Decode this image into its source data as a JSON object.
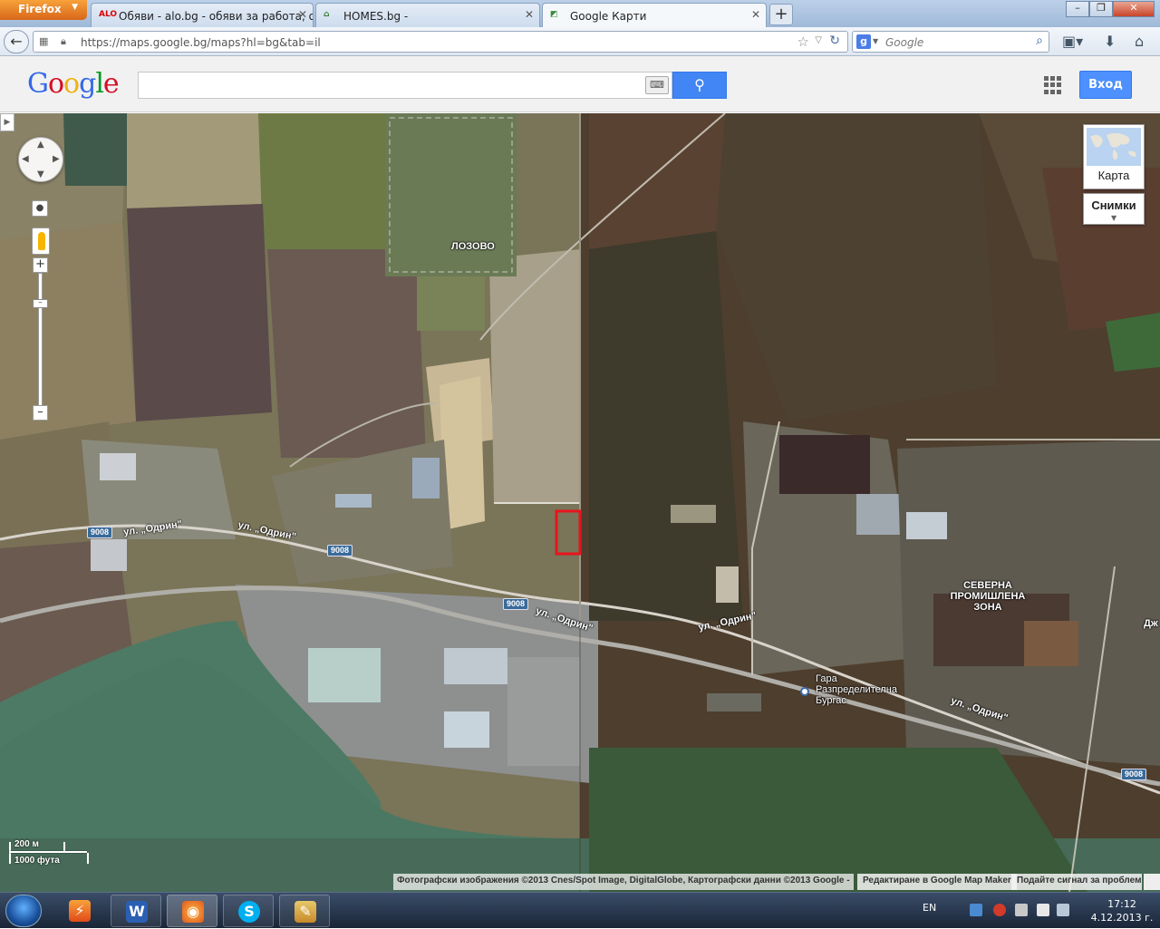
{
  "browser": {
    "menu_button": "Firefox",
    "tabs": [
      {
        "label": "Обяви - alo.bg - обяви за работа, об...",
        "icon": "alo-icon"
      },
      {
        "label": "HOMES.bg -",
        "icon": "homes-icon"
      },
      {
        "label": "Google Карти",
        "icon": "google-maps-icon"
      }
    ],
    "url": "https://maps.google.bg/maps?hl=bg&tab=il",
    "search_placeholder": "Google"
  },
  "header": {
    "logo": [
      "G",
      "o",
      "o",
      "g",
      "l",
      "e"
    ],
    "search_value": "",
    "signin_label": "Вход"
  },
  "map": {
    "labels": {
      "village": "ЛОЗОВО",
      "street_west_1": "ул. „Одрин\"",
      "street_west_2": "ул. „Одрин\"",
      "street_mid": "ул. „Одрин\"",
      "street_east_1": "ул. „Одрин\"",
      "street_east_2": "ул. „Одрин\"",
      "zone": "СЕВЕРНА ПРОМИШЛЕНА ЗОНА",
      "station": "Гара Разпределителна Бургас",
      "edge": "Дж"
    },
    "road_shields": [
      "9008",
      "9008",
      "9008",
      "9008"
    ],
    "map_type_map": "Карта",
    "map_type_satellite": "Снимки",
    "scale_metric": "200 м",
    "scale_imperial": "1000 фута",
    "attribution": "Фотографски изображения ©2013 Cnes/Spot Image, DigitalGlobe, Картографски данни ©2013 Google -",
    "map_maker_link": "Редактиране в Google Map Maker",
    "report_link": "Подайте сигнал за проблем",
    "marker_color": "#e8141c"
  },
  "taskbar": {
    "apps": [
      "firefox-icon",
      "word-icon",
      "firefox-icon",
      "skype-icon",
      "paint-icon"
    ],
    "language": "EN",
    "time": "17:12",
    "date": "4.12.2013 г."
  }
}
